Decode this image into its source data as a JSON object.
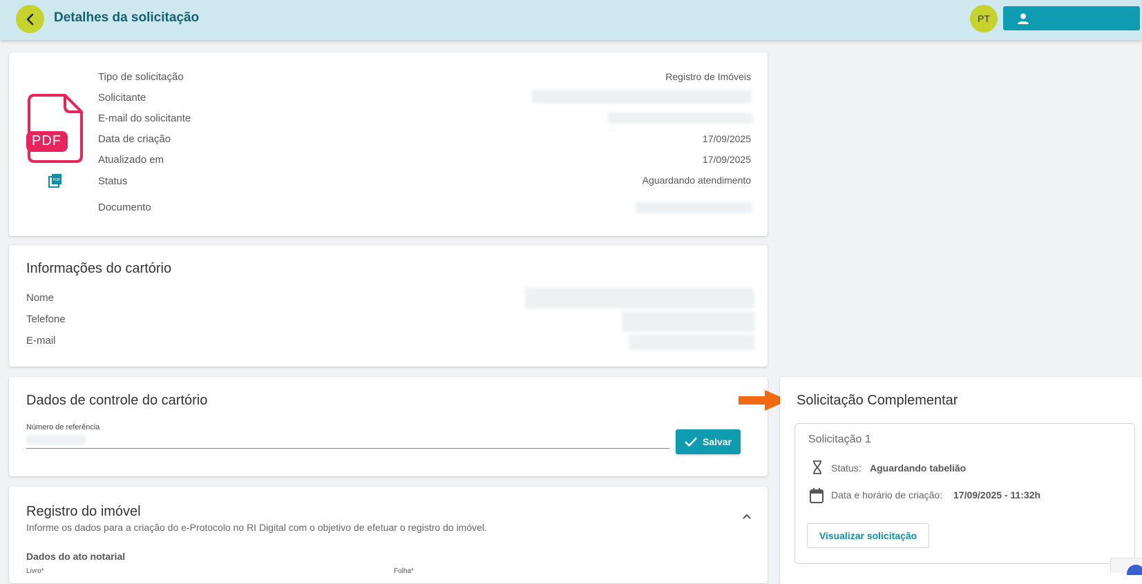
{
  "header": {
    "title": "Detalhes da solicitação",
    "avatar_initials": "PT"
  },
  "details": {
    "pdf_label": "PDF",
    "rows": [
      {
        "label": "Tipo de solicitação",
        "value": "Registro de Imóveis"
      },
      {
        "label": "Solicitante",
        "value": ""
      },
      {
        "label": "E-mail do solicitante",
        "value": ""
      },
      {
        "label": "Data de criação",
        "value": "17/09/2025"
      },
      {
        "label": "Atualizado em",
        "value": "17/09/2025"
      },
      {
        "label": "Status",
        "value": "Aguardando atendimento"
      },
      {
        "label": "Documento",
        "value": ""
      }
    ]
  },
  "cartorio": {
    "title": "Informações do cartório",
    "labels": [
      "Nome",
      "Telefone",
      "E-mail"
    ]
  },
  "controle": {
    "title": "Dados de controle do cartório",
    "field_label": "Número de referência",
    "save_label": "Salvar"
  },
  "registro": {
    "title": "Registro do imóvel",
    "description": "Informe os dados para a criação do e-Protocolo no RI Digital com o objetivo de efetuar o registro do imóvel.",
    "section_title": "Dados do ato notarial",
    "field_livro": "Livro*",
    "field_folha": "Folha*"
  },
  "complementar": {
    "title": "Solicitação Complementar",
    "item_title": "Solicitação 1",
    "status_label": "Status:",
    "status_value": "Aguardando tabelião",
    "date_label": "Data e horário de criação:",
    "date_value": "17/09/2025 - 11:32h",
    "view_button": "Visualizar solicitação"
  },
  "colors": {
    "accent": "#0f9bb0",
    "header_bg": "#cde9ef",
    "lime": "#c7d32d",
    "pdf_red": "#e8245c",
    "arrow": "#f26a10"
  }
}
